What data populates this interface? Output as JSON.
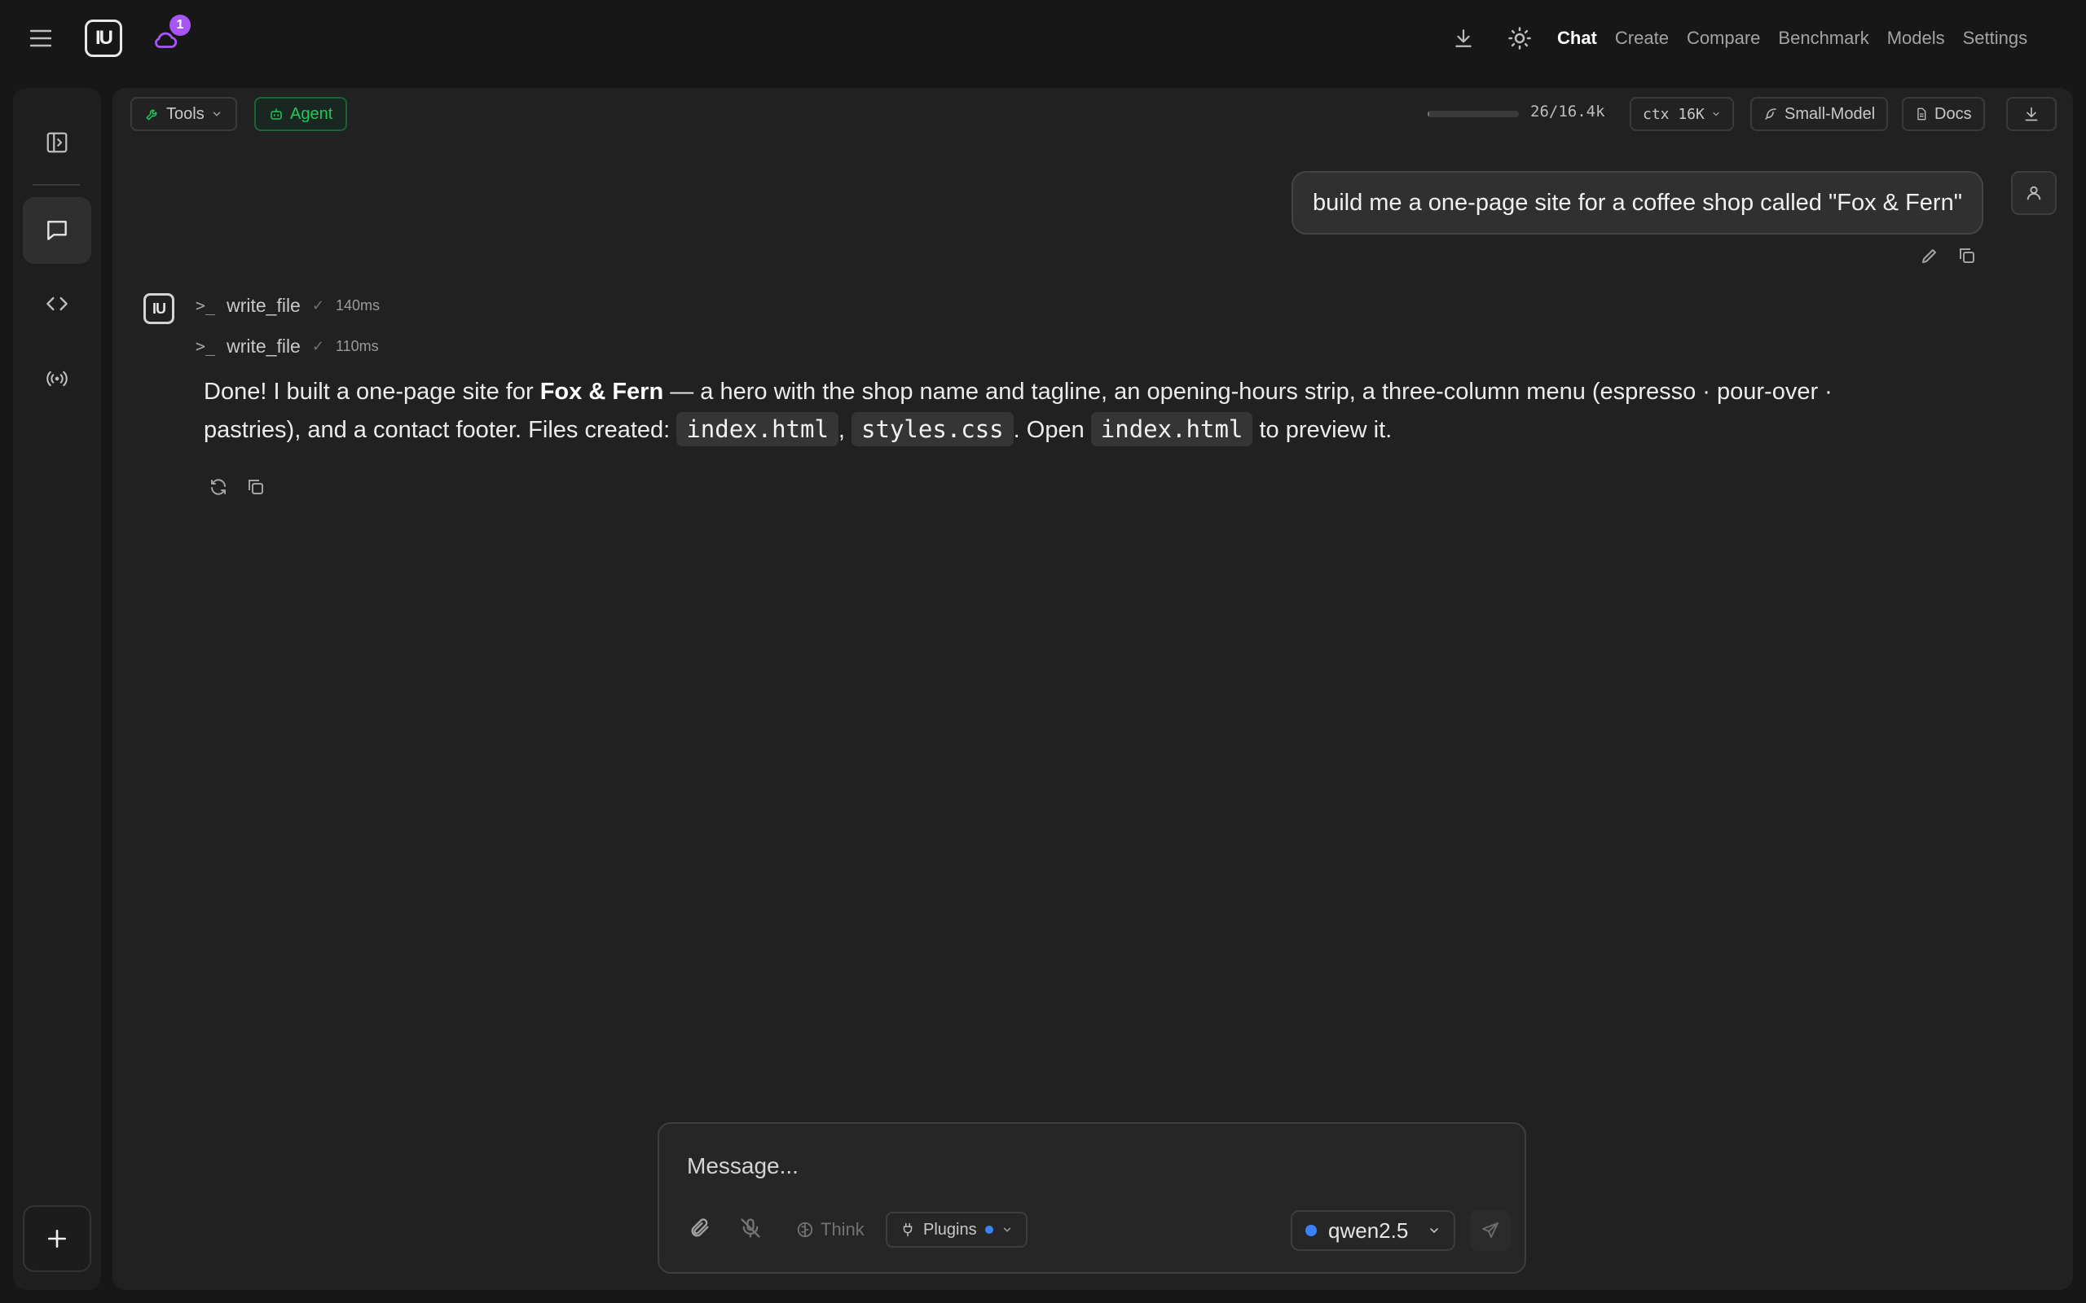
{
  "header": {
    "logo_text": "IU",
    "notification_count": "1",
    "nav": [
      "Chat",
      "Create",
      "Compare",
      "Benchmark",
      "Models",
      "Settings"
    ],
    "active_nav": "Chat"
  },
  "toolbar": {
    "tools_label": "Tools",
    "agent_label": "Agent",
    "token_usage": "26/16.4k",
    "token_fill_fraction": 0.0016,
    "ctx_label": "ctx 16K",
    "small_model_label": "Small-Model",
    "docs_label": "Docs"
  },
  "conversation": {
    "user_message": "build me a one-page site for a coffee shop called \"Fox & Fern\"",
    "tool_calls": [
      {
        "name": "write_file",
        "duration": "140ms"
      },
      {
        "name": "write_file",
        "duration": "110ms"
      }
    ],
    "answer": {
      "p1": "Done! I built a one-page site for ",
      "bold": "Fox & Fern",
      "p2": " — a hero with the shop name and tagline, an opening-hours strip, a three-column menu (espresso · pour-over · pastries), and a contact footer. Files created: ",
      "code1": "index.html",
      "sep": ", ",
      "code2": "styles.css",
      "p3": ". Open ",
      "code3": "index.html",
      "p4": " to preview it."
    }
  },
  "composer": {
    "placeholder": "Message...",
    "think_label": "Think",
    "plugins_label": "Plugins",
    "model_name": "qwen2.5"
  },
  "colors": {
    "accent_purple": "#a855f7",
    "agent_green": "#22c55e",
    "model_dot": "#3b82f6"
  }
}
